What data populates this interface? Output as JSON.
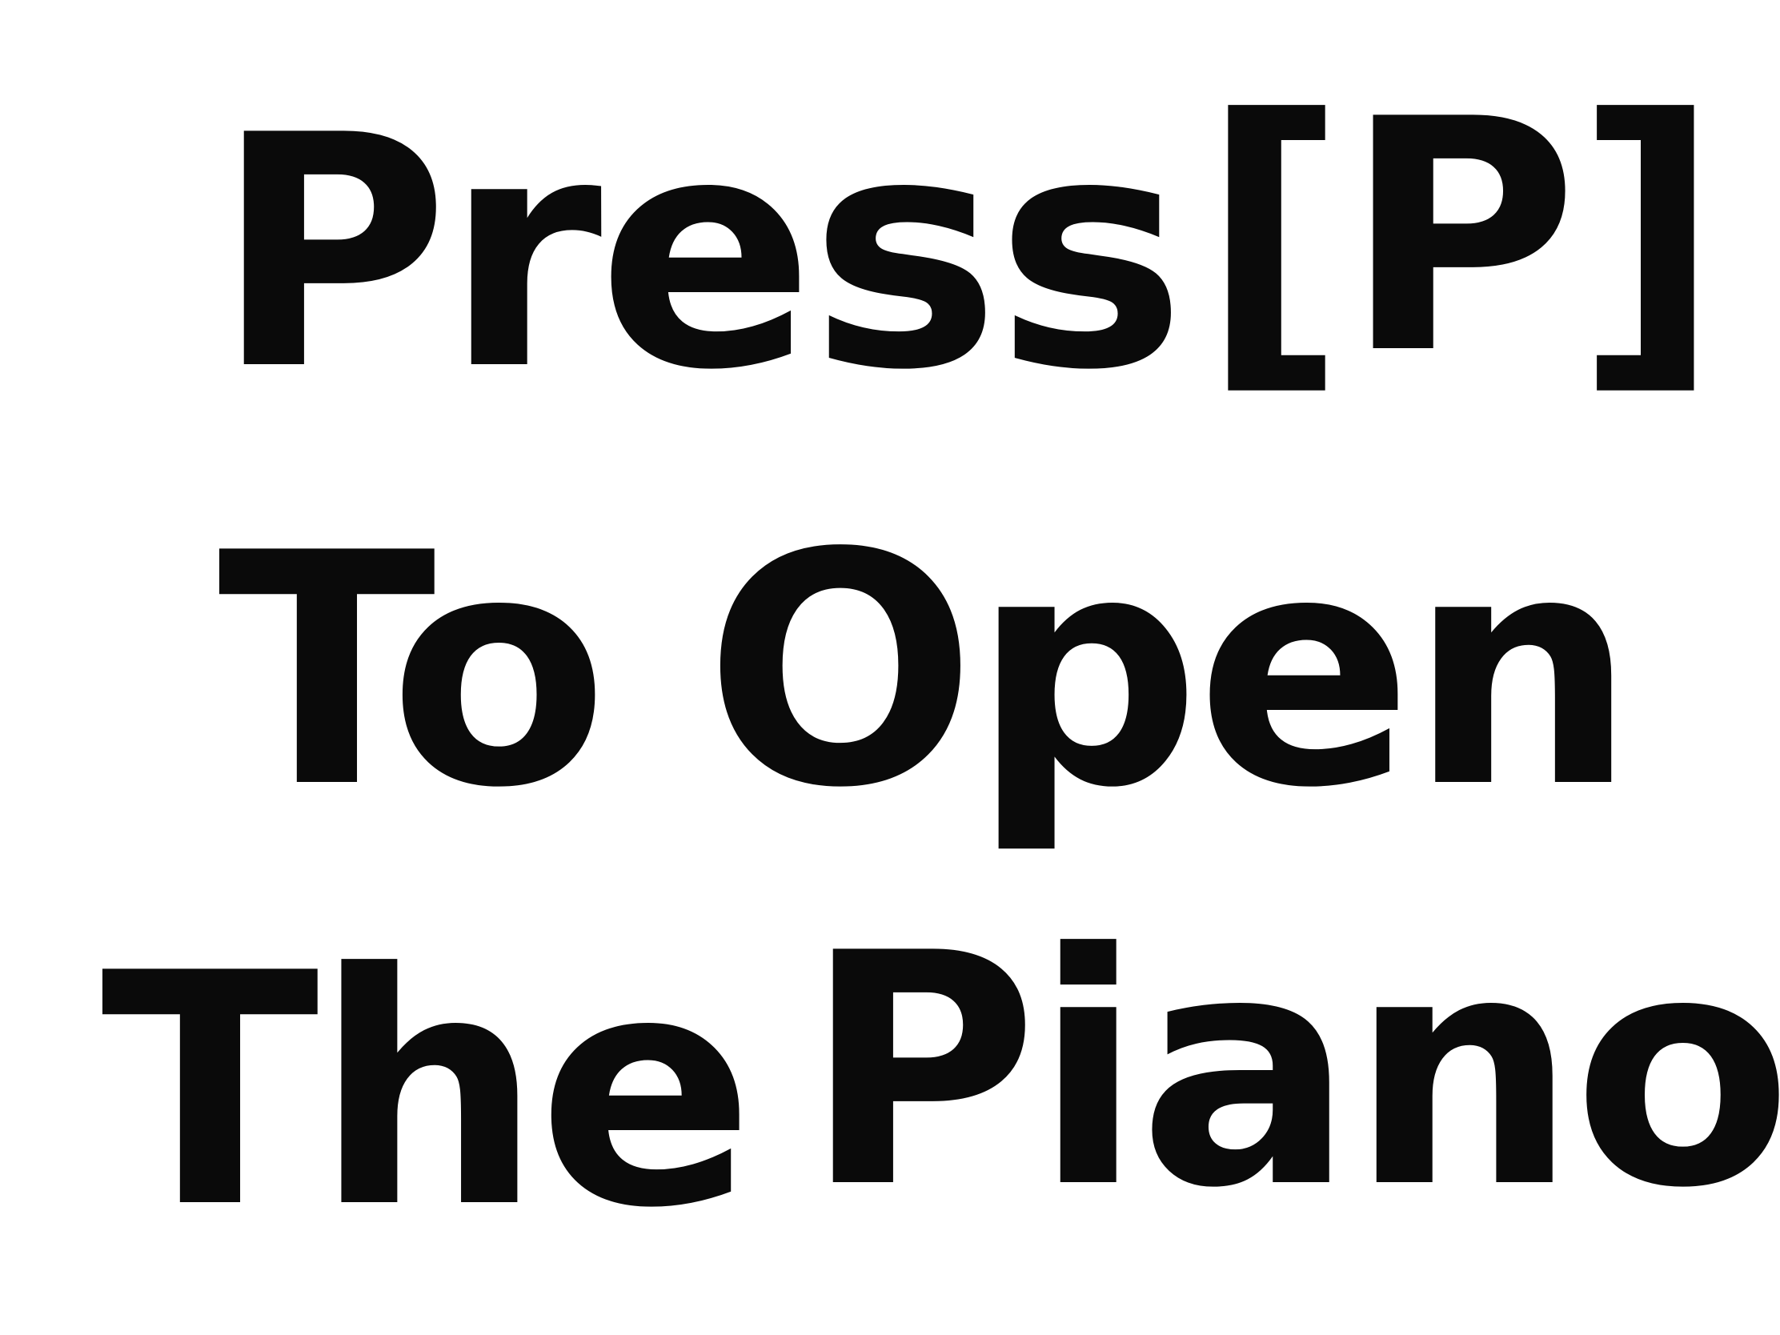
{
  "sign": {
    "line1": {
      "word1": "Press",
      "word2": "[P]"
    },
    "line2": {
      "word1": "To",
      "word2": "Open"
    },
    "line3": {
      "word1": "The",
      "word2": "Piano"
    }
  },
  "colors": {
    "background": "#ffffff",
    "text": "#0a0a0a"
  }
}
